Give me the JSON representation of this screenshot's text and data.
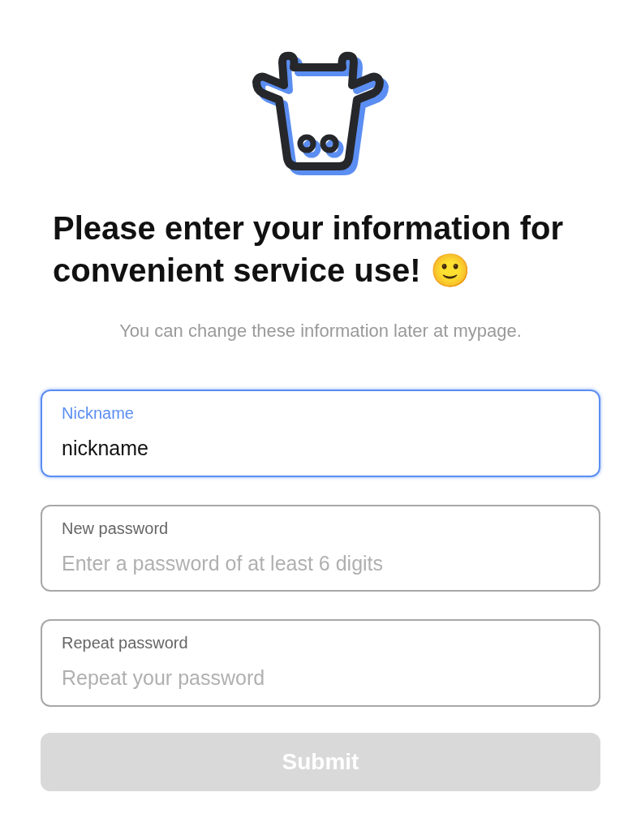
{
  "title": "Please enter your information for convenient service use! 🙂",
  "subtitle": "You can change these information later at mypage.",
  "fields": [
    {
      "label": "Nickname",
      "value": "nickname",
      "focused": true
    },
    {
      "label": "New password",
      "placeholder": "Enter a password of at least 6 digits",
      "focused": false
    },
    {
      "label": "Repeat password",
      "placeholder": "Repeat your password",
      "focused": false
    }
  ],
  "submit": {
    "label": "Submit",
    "disabled": true
  }
}
